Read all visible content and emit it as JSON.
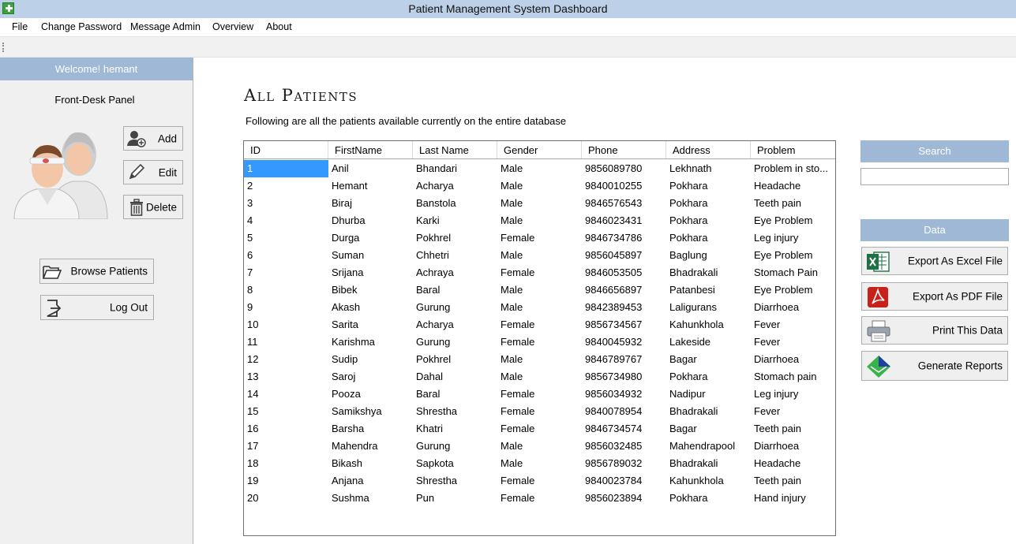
{
  "window": {
    "title": "Patient Management System Dashboard"
  },
  "menu": [
    "File",
    "Change Password",
    "Message Admin",
    "Overview",
    "About"
  ],
  "sidebar": {
    "welcome": "Welcome! hemant",
    "panel_title": "Front-Desk Panel",
    "add_label": "Add",
    "edit_label": "Edit",
    "delete_label": "Delete",
    "browse_label": "Browse Patients",
    "logout_label": "Log Out"
  },
  "main": {
    "title": "All Patients",
    "subtitle": "Following are all the patients available currently on the entire database"
  },
  "table": {
    "columns": [
      "ID",
      "FirstName",
      "Last Name",
      "Gender",
      "Phone",
      "Address",
      "Problem"
    ],
    "rows": [
      [
        "1",
        "Anil",
        "Bhandari",
        "Male",
        "9856089780",
        "Lekhnath",
        "Problem in sto..."
      ],
      [
        "2",
        "Hemant",
        "Acharya",
        "Male",
        "9840010255",
        "Pokhara",
        "Headache"
      ],
      [
        "3",
        "Biraj",
        "Banstola",
        "Male",
        "9846576543",
        "Pokhara",
        "Teeth pain"
      ],
      [
        "4",
        "Dhurba",
        "Karki",
        "Male",
        "9846023431",
        "Pokhara",
        "Eye Problem"
      ],
      [
        "5",
        "Durga",
        "Pokhrel",
        "Female",
        "9846734786",
        "Pokhara",
        "Leg injury"
      ],
      [
        "6",
        "Suman",
        "Chhetri",
        "Male",
        "9856045897",
        "Baglung",
        "Eye Problem"
      ],
      [
        "7",
        "Srijana",
        "Achraya",
        "Female",
        "9846053505",
        "Bhadrakali",
        "Stomach Pain"
      ],
      [
        "8",
        "Bibek",
        "Baral",
        "Male",
        "9846656897",
        "Patanbesi",
        "Eye Problem"
      ],
      [
        "9",
        "Akash",
        "Gurung",
        "Male",
        "9842389453",
        "Laligurans",
        "Diarrhoea"
      ],
      [
        "10",
        "Sarita",
        "Acharya",
        "Female",
        "9856734567",
        "Kahunkhola",
        "Fever"
      ],
      [
        "11",
        "Karishma",
        "Gurung",
        "Female",
        "9840045932",
        "Lakeside",
        "Fever"
      ],
      [
        "12",
        "Sudip",
        "Pokhrel",
        "Male",
        "9846789767",
        "Bagar",
        "Diarrhoea"
      ],
      [
        "13",
        "Saroj",
        "Dahal",
        "Male",
        "9856734980",
        "Pokhara",
        "Stomach pain"
      ],
      [
        "14",
        "Pooza",
        "Baral",
        "Female",
        "9856034932",
        "Nadipur",
        "Leg injury"
      ],
      [
        "15",
        "Samikshya",
        "Shrestha",
        "Female",
        "9840078954",
        "Bhadrakali",
        "Fever"
      ],
      [
        "16",
        "Barsha",
        "Khatri",
        "Female",
        "9846734574",
        "Bagar",
        "Teeth pain"
      ],
      [
        "17",
        "Mahendra",
        "Gurung",
        "Male",
        "9856032485",
        "Mahendrapool",
        "Diarrhoea"
      ],
      [
        "18",
        "Bikash",
        "Sapkota",
        "Male",
        "9856789032",
        "Bhadrakali",
        "Headache"
      ],
      [
        "19",
        "Anjana",
        "Shrestha",
        "Female",
        "9840023784",
        "Kahunkhola",
        "Teeth pain"
      ],
      [
        "20",
        "Sushma",
        "Pun",
        "Female",
        "9856023894",
        "Pokhara",
        "Hand injury"
      ]
    ],
    "selected_row": 1
  },
  "right": {
    "search_header": "Search",
    "search_value": "",
    "data_header": "Data",
    "excel_label": "Export As Excel File",
    "pdf_label": "Export As PDF File",
    "print_label": "Print This Data",
    "reports_label": "Generate Reports"
  },
  "colors": {
    "titlebar": "#bcd0e7",
    "panel_header": "#9fb8d6",
    "selection": "#3399ff"
  }
}
